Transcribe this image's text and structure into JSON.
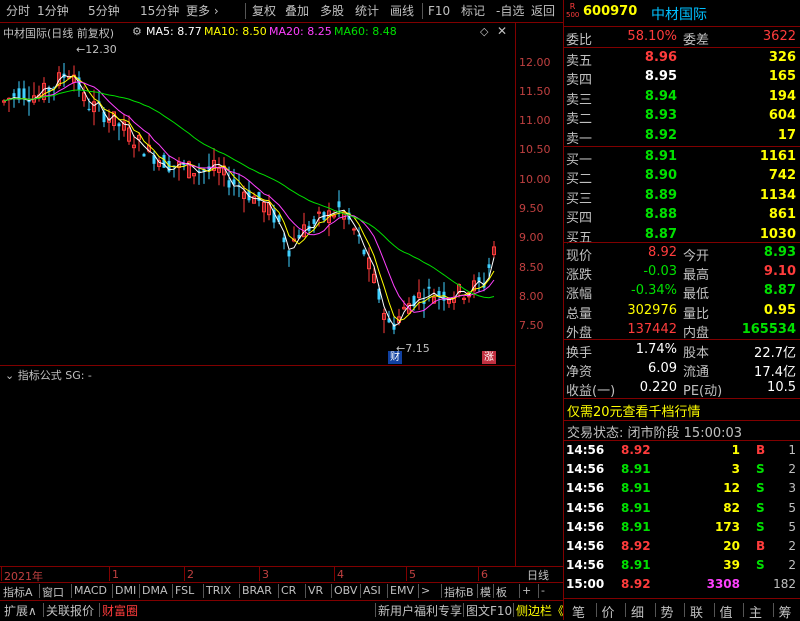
{
  "toolbar": {
    "items": [
      "分时",
      "1分钟",
      "5分钟",
      "15分钟",
      "更多 ›",
      "复权",
      "叠加",
      "多股",
      "统计",
      "画线",
      "F10",
      "标记",
      "-自选",
      "返回"
    ]
  },
  "chart": {
    "title": "中材国际(日线 前复权)",
    "ma5": "MA5: 8.77",
    "ma10": "MA10: 8.50",
    "ma20": "MA20: 8.25",
    "ma60": "MA60: 8.48",
    "high_label": "12.30",
    "low_label": "7.15",
    "cai_label": "财",
    "zhang_label": "涨",
    "yticks": [
      "12.00",
      "11.50",
      "11.00",
      "10.50",
      "10.00",
      "9.50",
      "9.00",
      "8.50",
      "8.00",
      "7.50"
    ],
    "colors": {
      "up": "#ff3c3c",
      "down": "#40d0ff",
      "ma5": "#ffffff",
      "ma10": "#ffff00",
      "ma20": "#ff40ff",
      "ma60": "#00e000"
    }
  },
  "chart_data": {
    "type": "candlestick",
    "yrange": [
      7.15,
      12.3
    ],
    "ma_values": {
      "MA5": 8.77,
      "MA10": 8.5,
      "MA20": 8.25,
      "MA60": 8.48
    },
    "high": 12.3,
    "low": 7.15,
    "x_labels": [
      "2021年",
      "1",
      "2",
      "3",
      "4",
      "5",
      "6"
    ]
  },
  "indicator": {
    "title": "指标公式 SG: -"
  },
  "xaxis": {
    "labels": [
      "2021年",
      "1",
      "2",
      "3",
      "4",
      "5",
      "6"
    ],
    "period": "日线"
  },
  "tabs1": [
    "指标A",
    "窗口",
    "MACD",
    "DMI",
    "DMA",
    "FSL",
    "TRIX",
    "BRAR",
    "CR",
    "VR",
    "OBV",
    "ASI",
    "EMV",
    ">",
    "指标B",
    "模",
    "板",
    "+",
    "-"
  ],
  "tabs2": [
    "扩展∧",
    "关联报价",
    "财富圈",
    "新用户福利专享",
    "图文F10",
    "侧边栏《"
  ],
  "stock": {
    "market_tag": "R 500",
    "code": "600970",
    "name": "中材国际",
    "weibi_label": "委比",
    "weibi_value": "58.10%",
    "weicha_label": "委差",
    "weicha_value": "3622"
  },
  "sell": [
    {
      "label": "卖五",
      "price": "8.96",
      "vol": "326"
    },
    {
      "label": "卖四",
      "price": "8.95",
      "vol": "165"
    },
    {
      "label": "卖三",
      "price": "8.94",
      "vol": "194"
    },
    {
      "label": "卖二",
      "price": "8.93",
      "vol": "604"
    },
    {
      "label": "卖一",
      "price": "8.92",
      "vol": "17"
    }
  ],
  "buy": [
    {
      "label": "买一",
      "price": "8.91",
      "vol": "1161"
    },
    {
      "label": "买二",
      "price": "8.90",
      "vol": "742"
    },
    {
      "label": "买三",
      "price": "8.89",
      "vol": "1134"
    },
    {
      "label": "买四",
      "price": "8.88",
      "vol": "861"
    },
    {
      "label": "买五",
      "price": "8.87",
      "vol": "1030"
    }
  ],
  "quote": [
    {
      "l1": "现价",
      "v1": "8.92",
      "l2": "今开",
      "v2": "8.93"
    },
    {
      "l1": "涨跌",
      "v1": "-0.03",
      "l2": "最高",
      "v2": "9.10"
    },
    {
      "l1": "涨幅",
      "v1": "-0.34%",
      "l2": "最低",
      "v2": "8.87"
    },
    {
      "l1": "总量",
      "v1": "302976",
      "l2": "量比",
      "v2": "0.95"
    },
    {
      "l1": "外盘",
      "v1": "137442",
      "l2": "内盘",
      "v2": "165534"
    }
  ],
  "fund": [
    {
      "l1": "换手",
      "v1": "1.74%",
      "l2": "股本",
      "v2": "22.7亿"
    },
    {
      "l1": "净资",
      "v1": "6.09",
      "l2": "流通",
      "v2": "17.4亿"
    },
    {
      "l1": "收益(一)",
      "v1": "0.220",
      "l2": "PE(动)",
      "v2": "10.5"
    }
  ],
  "promo": "仅需20元查看千档行情",
  "status_label": "交易状态: 闭市阶段",
  "status_time": "15:00:03",
  "ticks": [
    {
      "t": "14:56",
      "p": "8.92",
      "v": "1",
      "bs": "B",
      "n": "1"
    },
    {
      "t": "14:56",
      "p": "8.91",
      "v": "3",
      "bs": "S",
      "n": "2"
    },
    {
      "t": "14:56",
      "p": "8.91",
      "v": "12",
      "bs": "S",
      "n": "3"
    },
    {
      "t": "14:56",
      "p": "8.91",
      "v": "82",
      "bs": "S",
      "n": "5"
    },
    {
      "t": "14:56",
      "p": "8.91",
      "v": "173",
      "bs": "S",
      "n": "5"
    },
    {
      "t": "14:56",
      "p": "8.92",
      "v": "20",
      "bs": "B",
      "n": "2"
    },
    {
      "t": "14:56",
      "p": "8.91",
      "v": "39",
      "bs": "S",
      "n": "2"
    },
    {
      "t": "15:00",
      "p": "8.92",
      "v": "3308",
      "bs": "",
      "n": "182"
    }
  ],
  "right_tabs": [
    "笔",
    "价",
    "细",
    "势",
    "联",
    "值",
    "主",
    "筹"
  ]
}
